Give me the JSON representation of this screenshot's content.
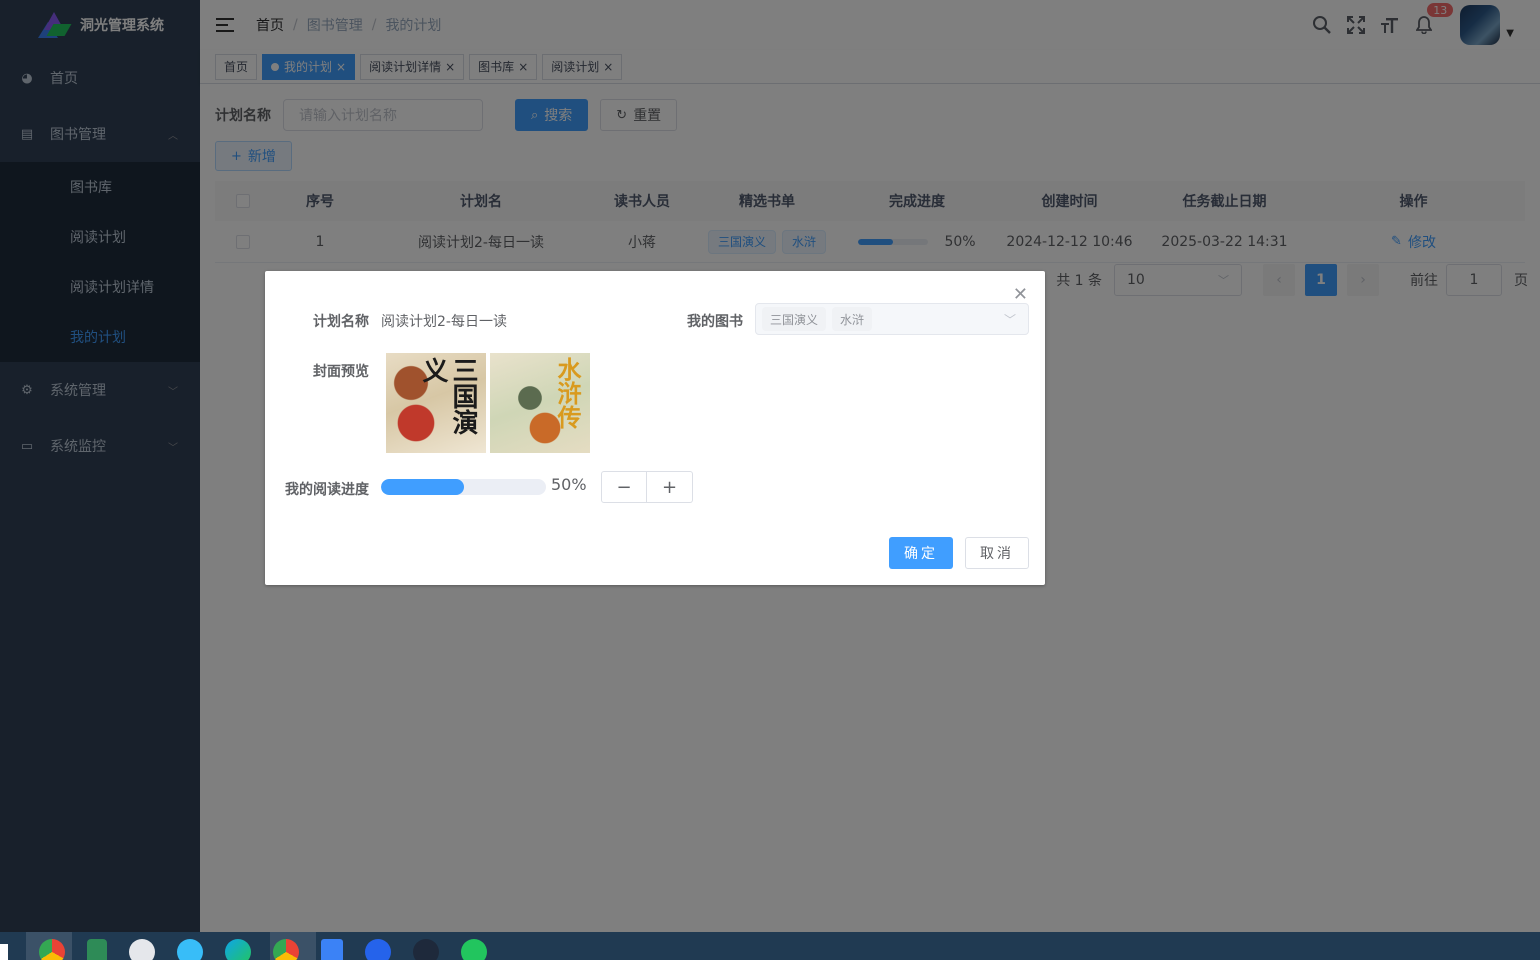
{
  "app": {
    "title": "洞光管理系统"
  },
  "sidebar": {
    "home": "首页",
    "books": {
      "label": "图书管理",
      "children": [
        "图书库",
        "阅读计划",
        "阅读计划详情",
        "我的计划"
      ],
      "active_index": 3
    },
    "system": "系统管理",
    "monitor": "系统监控"
  },
  "breadcrumb": [
    "首页",
    "图书管理",
    "我的计划"
  ],
  "breadcrumb_sep": "/",
  "navbar": {
    "notifications": "13"
  },
  "tags": {
    "home": "首页",
    "my_plan": "我的计划",
    "plan_detail": "阅读计划详情",
    "library": "图书库",
    "reading_plan": "阅读计划",
    "close": "×"
  },
  "search": {
    "label": "计划名称",
    "placeholder": "请输入计划名称",
    "search_btn": "搜索",
    "reset_btn": "重置",
    "add_btn": "新增"
  },
  "table": {
    "headers": [
      "序号",
      "计划名",
      "读书人员",
      "精选书单",
      "完成进度",
      "创建时间",
      "任务截止日期",
      "操作"
    ],
    "rows": [
      {
        "index": "1",
        "name": "阅读计划2-每日一读",
        "reader": "小蒋",
        "books": [
          "三国演义",
          "水浒"
        ],
        "progress": 50,
        "progress_label": "50%",
        "created": "2024-12-12 10:46",
        "deadline": "2025-03-22 14:31",
        "action": "修改"
      }
    ]
  },
  "pagination": {
    "total": "共 1 条",
    "page_size": "10",
    "current": "1",
    "goto": "前往",
    "goto_value": "1",
    "page_unit": "页"
  },
  "dialog": {
    "plan_label": "计划名称",
    "plan_value": "阅读计划2-每日一读",
    "books_label": "我的图书",
    "books_selected": [
      "三国演义",
      "水浒"
    ],
    "cover_label": "封面预览",
    "covers": [
      {
        "title": "三国演义"
      },
      {
        "title": "水浒传"
      }
    ],
    "progress_label": "我的阅读进度",
    "progress": 50,
    "progress_text": "50%",
    "minus": "−",
    "plus": "+",
    "confirm": "确定",
    "cancel": "取消"
  },
  "colors": {
    "sidebar_bg": "#304156",
    "submenu_bg": "#1f2d3d",
    "primary": "#409eff",
    "badge": "#f56c6c"
  },
  "icons": [
    "hamburger-icon",
    "search-icon",
    "fullscreen-icon",
    "font-size-icon",
    "bell-icon",
    "dashboard-icon",
    "book-icon",
    "gear-icon",
    "monitor-icon",
    "edit-icon",
    "close-icon"
  ]
}
